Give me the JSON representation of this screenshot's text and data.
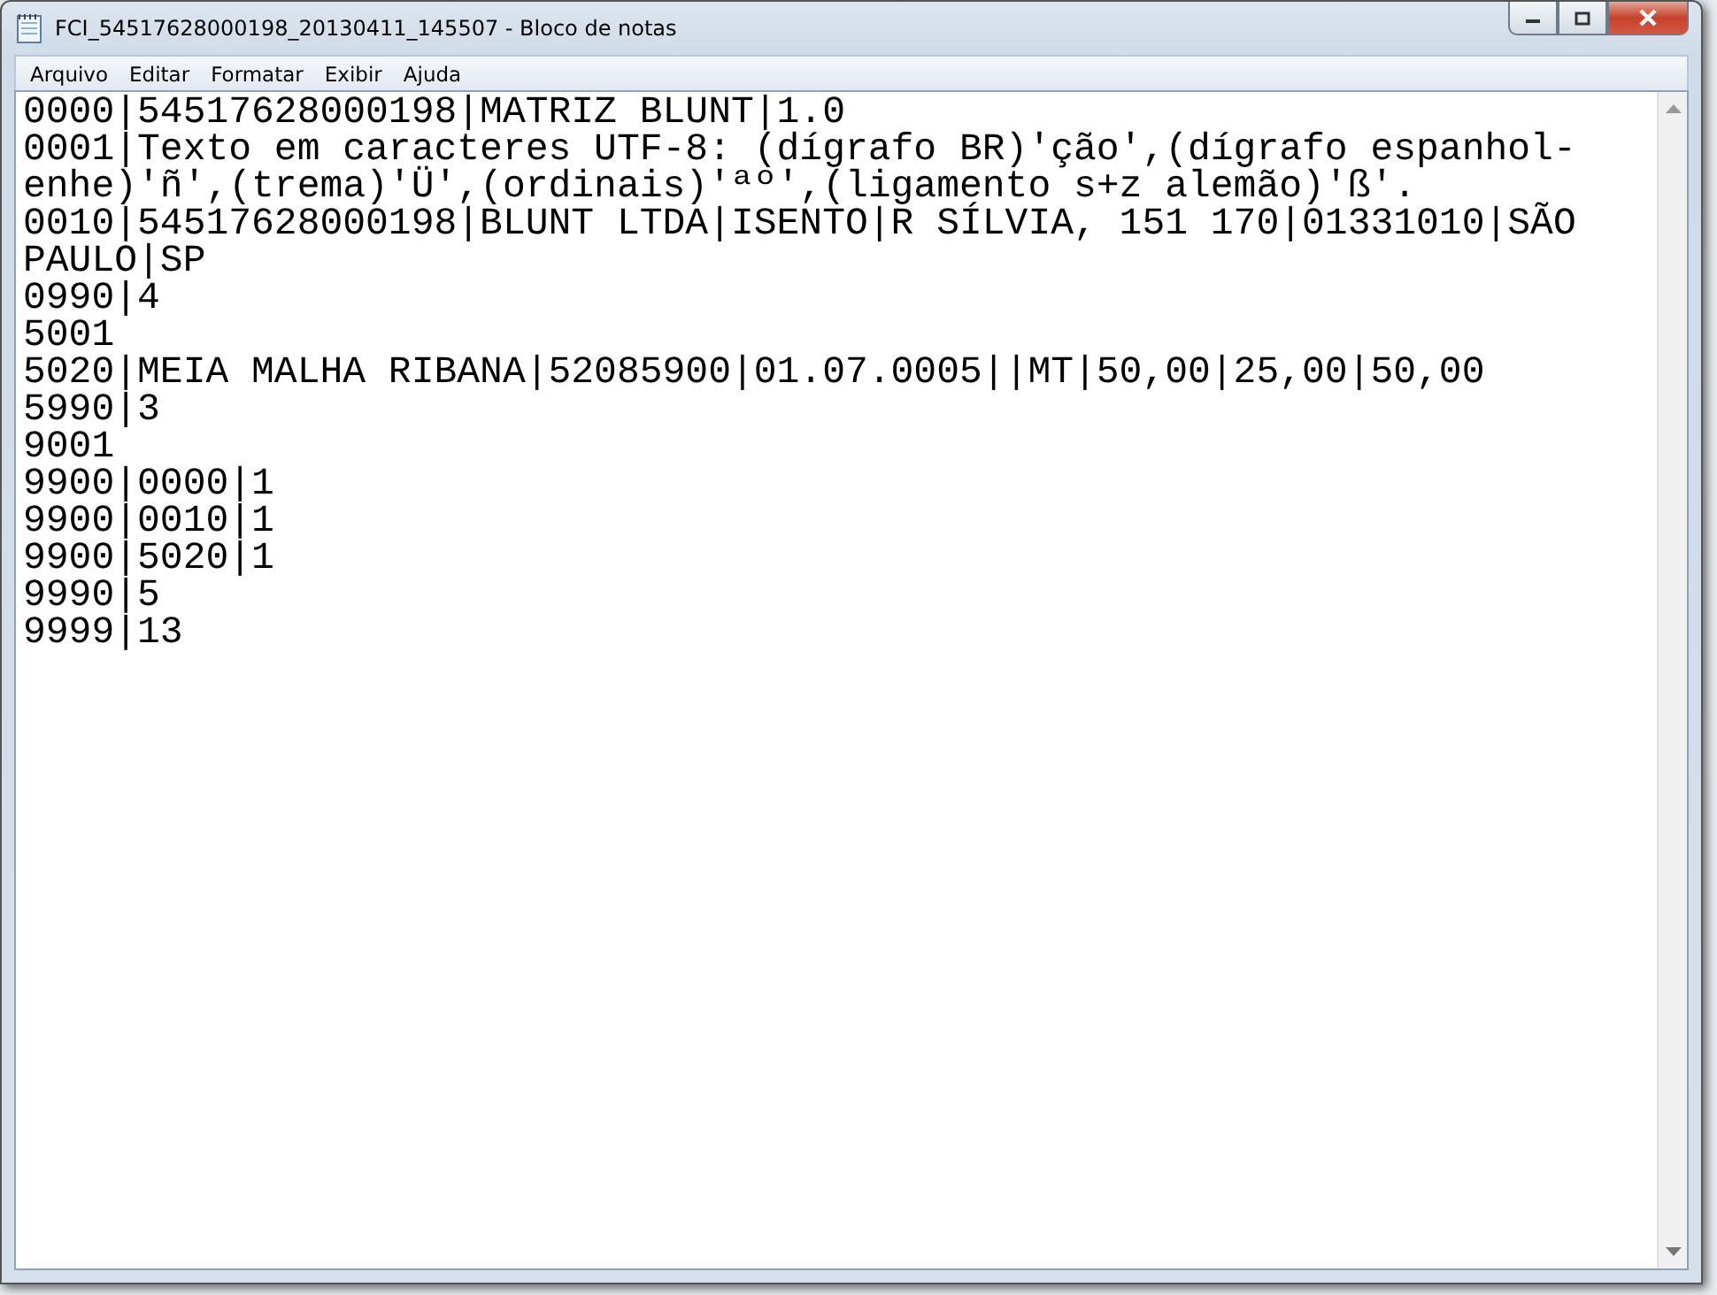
{
  "window": {
    "title": "FCI_54517628000198_20130411_145507 - Bloco de notas"
  },
  "menu": [
    "Arquivo",
    "Editar",
    "Formatar",
    "Exibir",
    "Ajuda"
  ],
  "editor": {
    "lines": [
      "0000|54517628000198|MATRIZ BLUNT|1.0",
      "0001|Texto em caracteres UTF-8: (dígrafo BR)'ção',(dígrafo espanhol-",
      "enhe)'ñ',(trema)'Ü',(ordinais)'ªº',(ligamento s+z alemão)'ß'.",
      "0010|54517628000198|BLUNT LTDA|ISENTO|R SÍLVIA, 151 170|01331010|SÃO",
      "PAULO|SP",
      "0990|4",
      "5001",
      "5020|MEIA MALHA RIBANA|52085900|01.07.0005||MT|50,00|25,00|50,00",
      "5990|3",
      "9001",
      "9900|0000|1",
      "9900|0010|1",
      "9900|5020|1",
      "9990|5",
      "9999|13"
    ]
  }
}
